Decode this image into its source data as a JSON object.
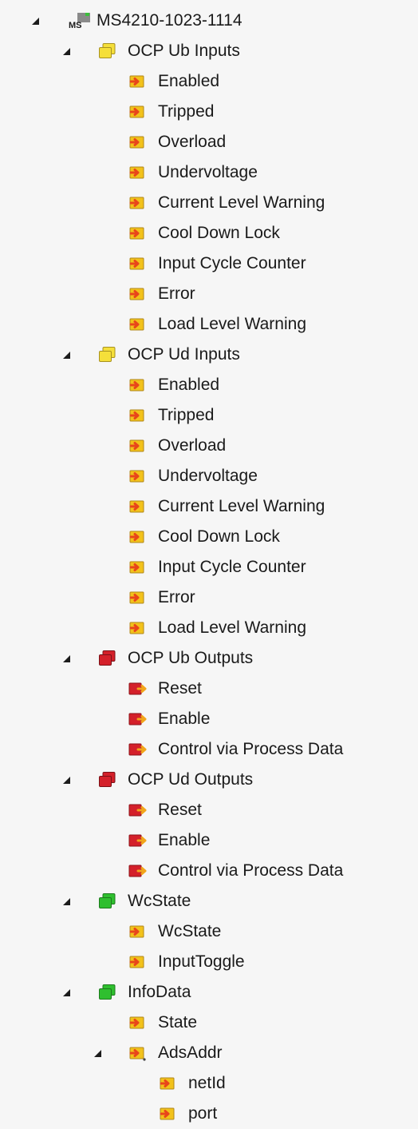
{
  "tree": {
    "root": {
      "label": "MS4210-1023-1114",
      "icon": "device-ms-icon",
      "badge": "MS"
    },
    "groups": [
      {
        "label": "OCP Ub Inputs",
        "icon": "input-folder-icon",
        "color": "#f5df3a",
        "items": [
          "Enabled",
          "Tripped",
          "Overload",
          "Undervoltage",
          "Current Level Warning",
          "Cool Down Lock",
          "Input Cycle Counter",
          "Error",
          "Load Level Warning"
        ],
        "item_icon": "input-variable-icon"
      },
      {
        "label": "OCP Ud Inputs",
        "icon": "input-folder-icon",
        "color": "#f5df3a",
        "items": [
          "Enabled",
          "Tripped",
          "Overload",
          "Undervoltage",
          "Current Level Warning",
          "Cool Down Lock",
          "Input Cycle Counter",
          "Error",
          "Load Level Warning"
        ],
        "item_icon": "input-variable-icon"
      },
      {
        "label": "OCP Ub Outputs",
        "icon": "output-folder-icon",
        "color": "#d4202a",
        "items": [
          "Reset",
          "Enable",
          "Control via Process Data"
        ],
        "item_icon": "output-variable-icon"
      },
      {
        "label": "OCP Ud Outputs",
        "icon": "output-folder-icon",
        "color": "#d4202a",
        "items": [
          "Reset",
          "Enable",
          "Control via Process Data"
        ],
        "item_icon": "output-variable-icon"
      },
      {
        "label": "WcState",
        "icon": "status-folder-icon",
        "color": "#2fbf2f",
        "items": [
          "WcState",
          "InputToggle"
        ],
        "item_icon": "input-variable-icon"
      },
      {
        "label": "InfoData",
        "icon": "status-folder-icon",
        "color": "#2fbf2f",
        "items": [
          "State"
        ],
        "item_icon": "input-variable-icon",
        "subgroup": {
          "label": "AdsAddr",
          "icon": "input-variable-struct-icon",
          "items": [
            "netId",
            "port"
          ],
          "item_icon": "input-variable-icon"
        }
      }
    ]
  },
  "colors": {
    "input_var": "#f2c21b",
    "output_var": "#d4202a",
    "arrow": "#e8461a"
  }
}
